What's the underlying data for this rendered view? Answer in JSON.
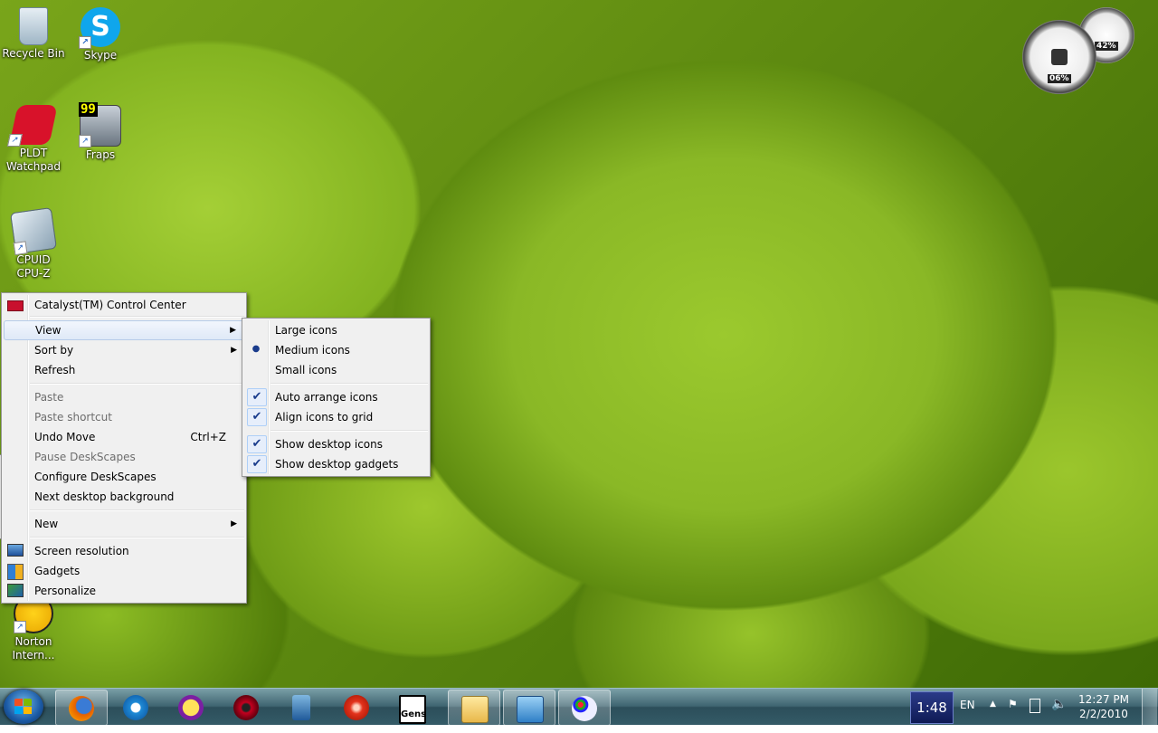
{
  "desktop_icons": [
    {
      "label": "Recycle Bin",
      "icon": "recycle-bin-icon"
    },
    {
      "label": "Skype",
      "icon": "skype-icon"
    },
    {
      "label": "PLDT\nWatchpad",
      "icon": "pldt-watchpad-icon"
    },
    {
      "label": "Fraps",
      "icon": "fraps-icon",
      "badge": "99"
    },
    {
      "label": "CPUID\nCPU-Z",
      "icon": "cpu-z-icon"
    },
    {
      "label": "Norton\nIntern...",
      "icon": "norton-icon"
    }
  ],
  "gadget": {
    "cpu_label": "06%",
    "memory_label": "42%"
  },
  "context_menu": {
    "items": [
      {
        "label": "Catalyst(TM) Control Center",
        "icon": "ati-icon"
      },
      {
        "label": "View",
        "submenu": true
      },
      {
        "label": "Sort by",
        "submenu": true
      },
      {
        "label": "Refresh"
      },
      {
        "label": "Paste",
        "disabled": true
      },
      {
        "label": "Paste shortcut",
        "disabled": true
      },
      {
        "label": "Undo Move",
        "shortcut": "Ctrl+Z"
      },
      {
        "label": "Pause DeskScapes",
        "disabled": true
      },
      {
        "label": "Configure DeskScapes"
      },
      {
        "label": "Next desktop background"
      },
      {
        "label": "New",
        "submenu": true
      },
      {
        "label": "Screen resolution",
        "icon": "screen-resolution-icon"
      },
      {
        "label": "Gadgets",
        "icon": "gadgets-icon"
      },
      {
        "label": "Personalize",
        "icon": "personalize-icon"
      }
    ]
  },
  "view_submenu": {
    "items": [
      {
        "label": "Large icons"
      },
      {
        "label": "Medium icons",
        "selected": true
      },
      {
        "label": "Small icons"
      },
      {
        "label": "Auto arrange icons",
        "checked": true
      },
      {
        "label": "Align icons to grid",
        "checked": true
      },
      {
        "label": "Show desktop icons",
        "checked": true
      },
      {
        "label": "Show desktop gadgets",
        "checked": true
      }
    ]
  },
  "taskbar": {
    "buttons": [
      "firefox-icon",
      "internet-explorer-icon",
      "yahoo-messenger-icon",
      "debian-swirl-icon",
      "media-player-icon",
      "red-swirl-icon",
      "gens-icon",
      "windows-explorer-icon",
      "control-panel-icon",
      "paint-icon"
    ],
    "gens_label": "Gens",
    "clock_gadget": "1:48",
    "language": "EN",
    "time": "12:27 PM",
    "date": "2/2/2010"
  },
  "colors": {
    "menu_bg": "#f0f0f0",
    "highlight": "#dfe9f7",
    "taskbar": "#3f6571"
  }
}
